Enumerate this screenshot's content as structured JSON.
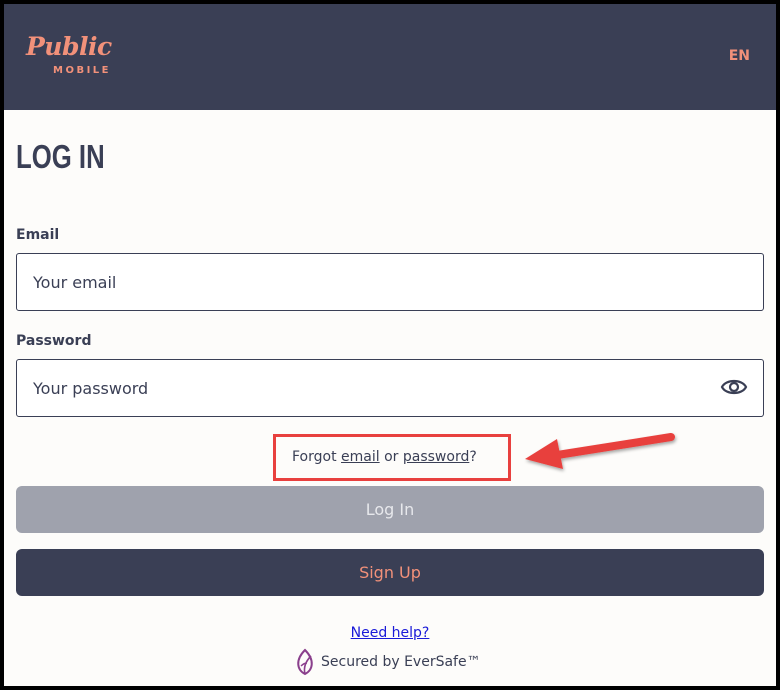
{
  "header": {
    "logo_main": "Public",
    "logo_sub": "MOBILE",
    "language": "EN"
  },
  "page_title": "LOG IN",
  "email": {
    "label": "Email",
    "placeholder": "Your email"
  },
  "password": {
    "label": "Password",
    "placeholder": "Your password"
  },
  "forgot": {
    "prefix": "Forgot ",
    "email_link": "email",
    "middle": " or ",
    "password_link": "password",
    "suffix": "?"
  },
  "buttons": {
    "login": "Log In",
    "signup": "Sign Up"
  },
  "footer": {
    "help_link": "Need help?",
    "secured_text": "Secured by EverSafe™"
  },
  "colors": {
    "header_bg": "#3a3f55",
    "accent": "#f2917a",
    "annotation": "#e8403e",
    "disabled_button": "#9fa2ad",
    "link": "#1a1ad8"
  },
  "icons": {
    "password_toggle": "eye-icon",
    "eversafe": "leaf-icon"
  }
}
